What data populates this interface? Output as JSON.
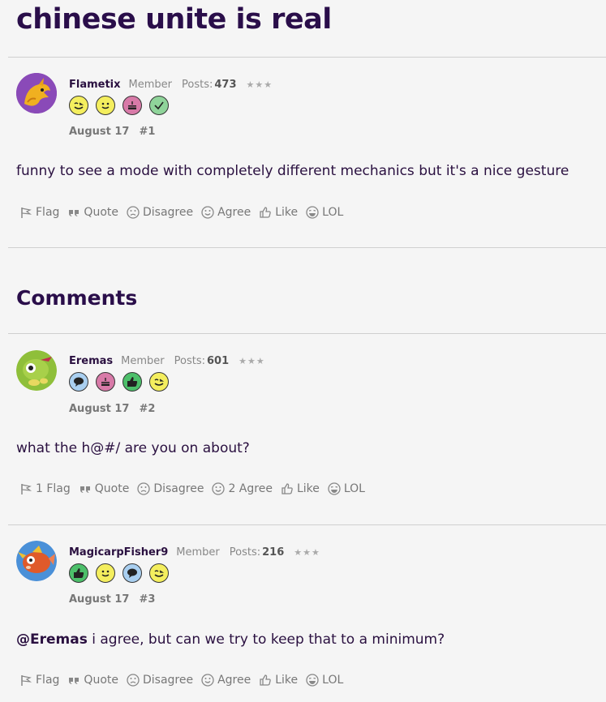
{
  "title": "chinese unite is real",
  "comments_heading": "Comments",
  "colors": {
    "title": "#2a0e4a",
    "badge_yellow": "#f4ee5e",
    "badge_pink": "#d87aa8",
    "badge_green_check": "#8fd49a",
    "badge_blue": "#a9cff0",
    "badge_green_thumb": "#4cbf6a"
  },
  "posts": [
    {
      "username": "Flametix",
      "role": "Member",
      "posts_label": "Posts:",
      "posts_count": "473",
      "stars": "★★★",
      "badges": [
        "wink-face",
        "smile-face",
        "cake",
        "check"
      ],
      "date": "August 17",
      "number": "#1",
      "body": "funny to see a mode with completely different mechanics but it's a nice gesture",
      "actions": {
        "flag": "Flag",
        "quote": "Quote",
        "disagree": "Disagree",
        "agree": "Agree",
        "like": "Like",
        "lol": "LOL"
      }
    },
    {
      "username": "Eremas",
      "role": "Member",
      "posts_label": "Posts:",
      "posts_count": "601",
      "stars": "★★★",
      "badges": [
        "speech-bubble",
        "cake",
        "thumbs-up",
        "wink-face"
      ],
      "date": "August 17",
      "number": "#2",
      "body": "what the h@#/ are you on about?",
      "actions": {
        "flag": "1 Flag",
        "quote": "Quote",
        "disagree": "Disagree",
        "agree": "2 Agree",
        "like": "Like",
        "lol": "LOL"
      }
    },
    {
      "username": "MagicarpFisher9",
      "role": "Member",
      "posts_label": "Posts:",
      "posts_count": "216",
      "stars": "★★★",
      "badges": [
        "thumbs-up",
        "smile-face",
        "speech-bubble",
        "wink-face"
      ],
      "date": "August 17",
      "number": "#3",
      "mention": "@Eremas",
      "body": " i agree, but can we try to keep that to a minimum?",
      "actions": {
        "flag": "Flag",
        "quote": "Quote",
        "disagree": "Disagree",
        "agree": "Agree",
        "like": "Like",
        "lol": "LOL"
      }
    }
  ]
}
